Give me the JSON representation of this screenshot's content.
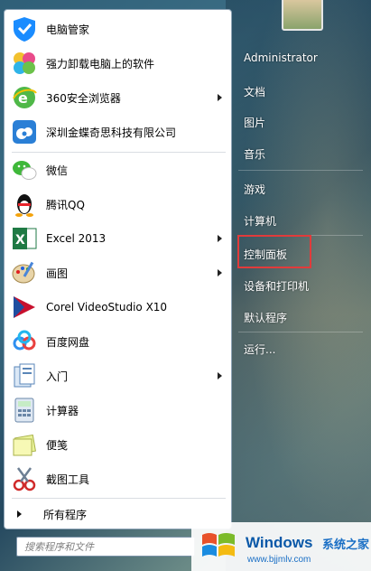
{
  "pinned": [
    {
      "label": "电脑管家",
      "icon": "tencent-pc-manager-icon",
      "arrow": false
    },
    {
      "label": "强力卸载电脑上的软件",
      "icon": "uninstaller-petals-icon",
      "arrow": false
    },
    {
      "label": "360安全浏览器",
      "icon": "360-browser-icon",
      "arrow": true
    },
    {
      "label": "深圳金蝶奇思科技有限公司",
      "icon": "cloud-gear-icon",
      "arrow": false
    }
  ],
  "recent": [
    {
      "label": "微信",
      "icon": "wechat-icon",
      "arrow": false
    },
    {
      "label": "腾讯QQ",
      "icon": "qq-penguin-icon",
      "arrow": false
    },
    {
      "label": "Excel 2013",
      "icon": "excel-icon",
      "arrow": true
    },
    {
      "label": "画图",
      "icon": "paint-palette-icon",
      "arrow": true
    },
    {
      "label": "Corel VideoStudio X10",
      "icon": "corel-videostudio-icon",
      "arrow": false
    },
    {
      "label": "百度网盘",
      "icon": "baidu-netdisk-icon",
      "arrow": false
    },
    {
      "label": "入门",
      "icon": "getting-started-icon",
      "arrow": true
    },
    {
      "label": "计算器",
      "icon": "calculator-icon",
      "arrow": false
    },
    {
      "label": "便笺",
      "icon": "sticky-notes-icon",
      "arrow": false
    },
    {
      "label": "截图工具",
      "icon": "snipping-tool-icon",
      "arrow": false
    }
  ],
  "all_programs": "所有程序",
  "search": {
    "placeholder": "搜索程序和文件"
  },
  "right": {
    "user": "Administrator",
    "documents": "文档",
    "pictures": "图片",
    "music": "音乐",
    "games": "游戏",
    "computer": "计算机",
    "control_panel": "控制面板",
    "devices": "设备和打印机",
    "default_programs": "默认程序",
    "run": "运行..."
  },
  "watermark": {
    "brand": "Windows",
    "site_cn": "系统之家",
    "url": "www.bjjmlv.com"
  },
  "colors": {
    "highlight": "#e13b3b",
    "brand_blue": "#0a58a8"
  }
}
